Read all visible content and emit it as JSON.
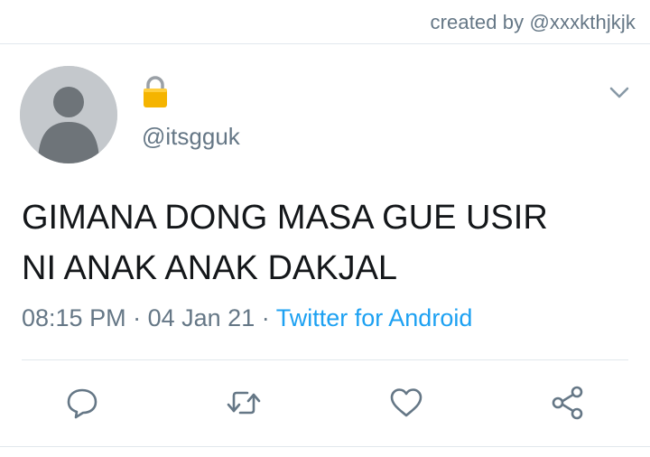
{
  "header": {
    "credit": "created by @xxxkthjkjk"
  },
  "tweet": {
    "avatar_icon": "default-avatar-icon",
    "lock_icon": "lock-icon",
    "handle": "@itsgguk",
    "text_lines": [
      "GIMANA DONG MASA GUE USIR",
      "NI ANAK ANAK DAKJAL"
    ],
    "time": "08:15 PM",
    "separator": "·",
    "date": "04 Jan 21",
    "source": "Twitter for Android"
  },
  "actions": [
    {
      "icon": "reply-icon"
    },
    {
      "icon": "retweet-icon"
    },
    {
      "icon": "like-icon"
    },
    {
      "icon": "share-icon"
    }
  ],
  "colors": {
    "text": "#14171a",
    "muted": "#657786",
    "link": "#1da1f2",
    "divider": "#e1e8ed",
    "avatar_bg": "#c4c8cc",
    "avatar_fg": "#6e7479",
    "lock": "#f5b400"
  }
}
